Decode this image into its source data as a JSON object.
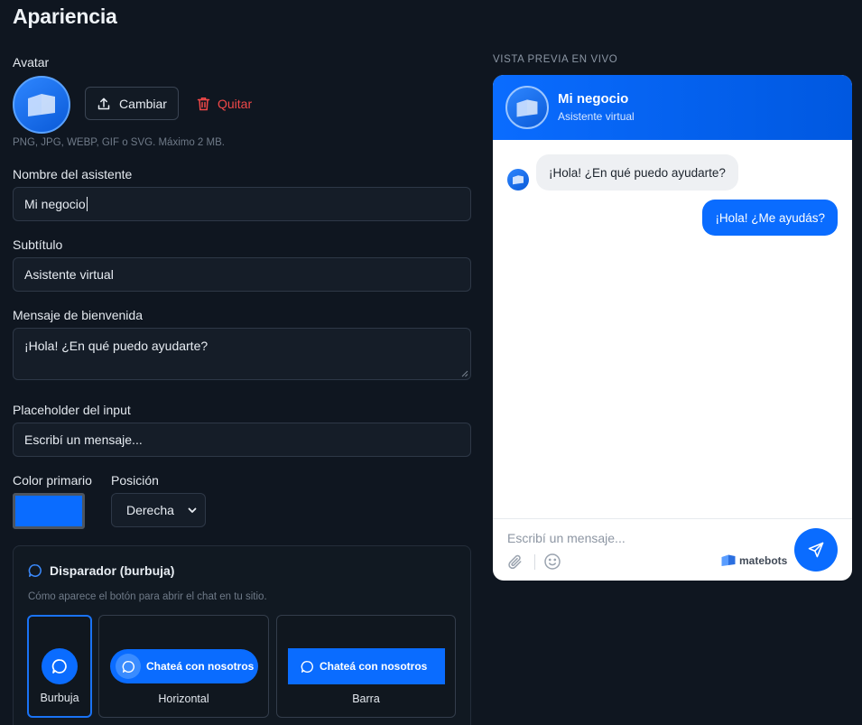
{
  "page": {
    "title": "Apariencia"
  },
  "avatar": {
    "label": "Avatar",
    "change_label": "Cambiar",
    "remove_label": "Quitar",
    "hint": "PNG, JPG, WEBP, GIF o SVG. Máximo 2 MB."
  },
  "form": {
    "name_label": "Nombre del asistente",
    "name_value": "Mi negocio",
    "subtitle_label": "Subtítulo",
    "subtitle_value": "Asistente virtual",
    "welcome_label": "Mensaje de bienvenida",
    "welcome_value": "¡Hola! ¿En qué puedo ayudarte?",
    "placeholder_label": "Placeholder del input",
    "placeholder_value": "Escribí un mensaje...",
    "color_label": "Color primario",
    "color_value": "#0a6cff",
    "position_label": "Posición",
    "position_value": "Derecha"
  },
  "trigger": {
    "title": "Disparador (burbuja)",
    "hint": "Cómo aparece el botón para abrir el chat en tu sitio.",
    "options": [
      {
        "label": "Burbuja",
        "selected": true
      },
      {
        "label": "Horizontal",
        "selected": false,
        "button_text": "Chateá con nosotros"
      },
      {
        "label": "Barra",
        "selected": false,
        "button_text": "Chateá con nosotros"
      }
    ]
  },
  "preview": {
    "label": "VISTA PREVIA EN VIVO",
    "name": "Mi negocio",
    "subtitle": "Asistente virtual",
    "bot_message": "¡Hola! ¿En qué puedo ayudarte?",
    "user_message": "¡Hola! ¿Me ayudás?",
    "input_placeholder": "Escribí un mensaje...",
    "brand": "matebots",
    "icons": [
      "paperclip-icon",
      "emoji-icon",
      "send-icon"
    ]
  },
  "colors": {
    "accent": "#0a6cff",
    "danger": "#f04848",
    "background": "#0f1620"
  }
}
